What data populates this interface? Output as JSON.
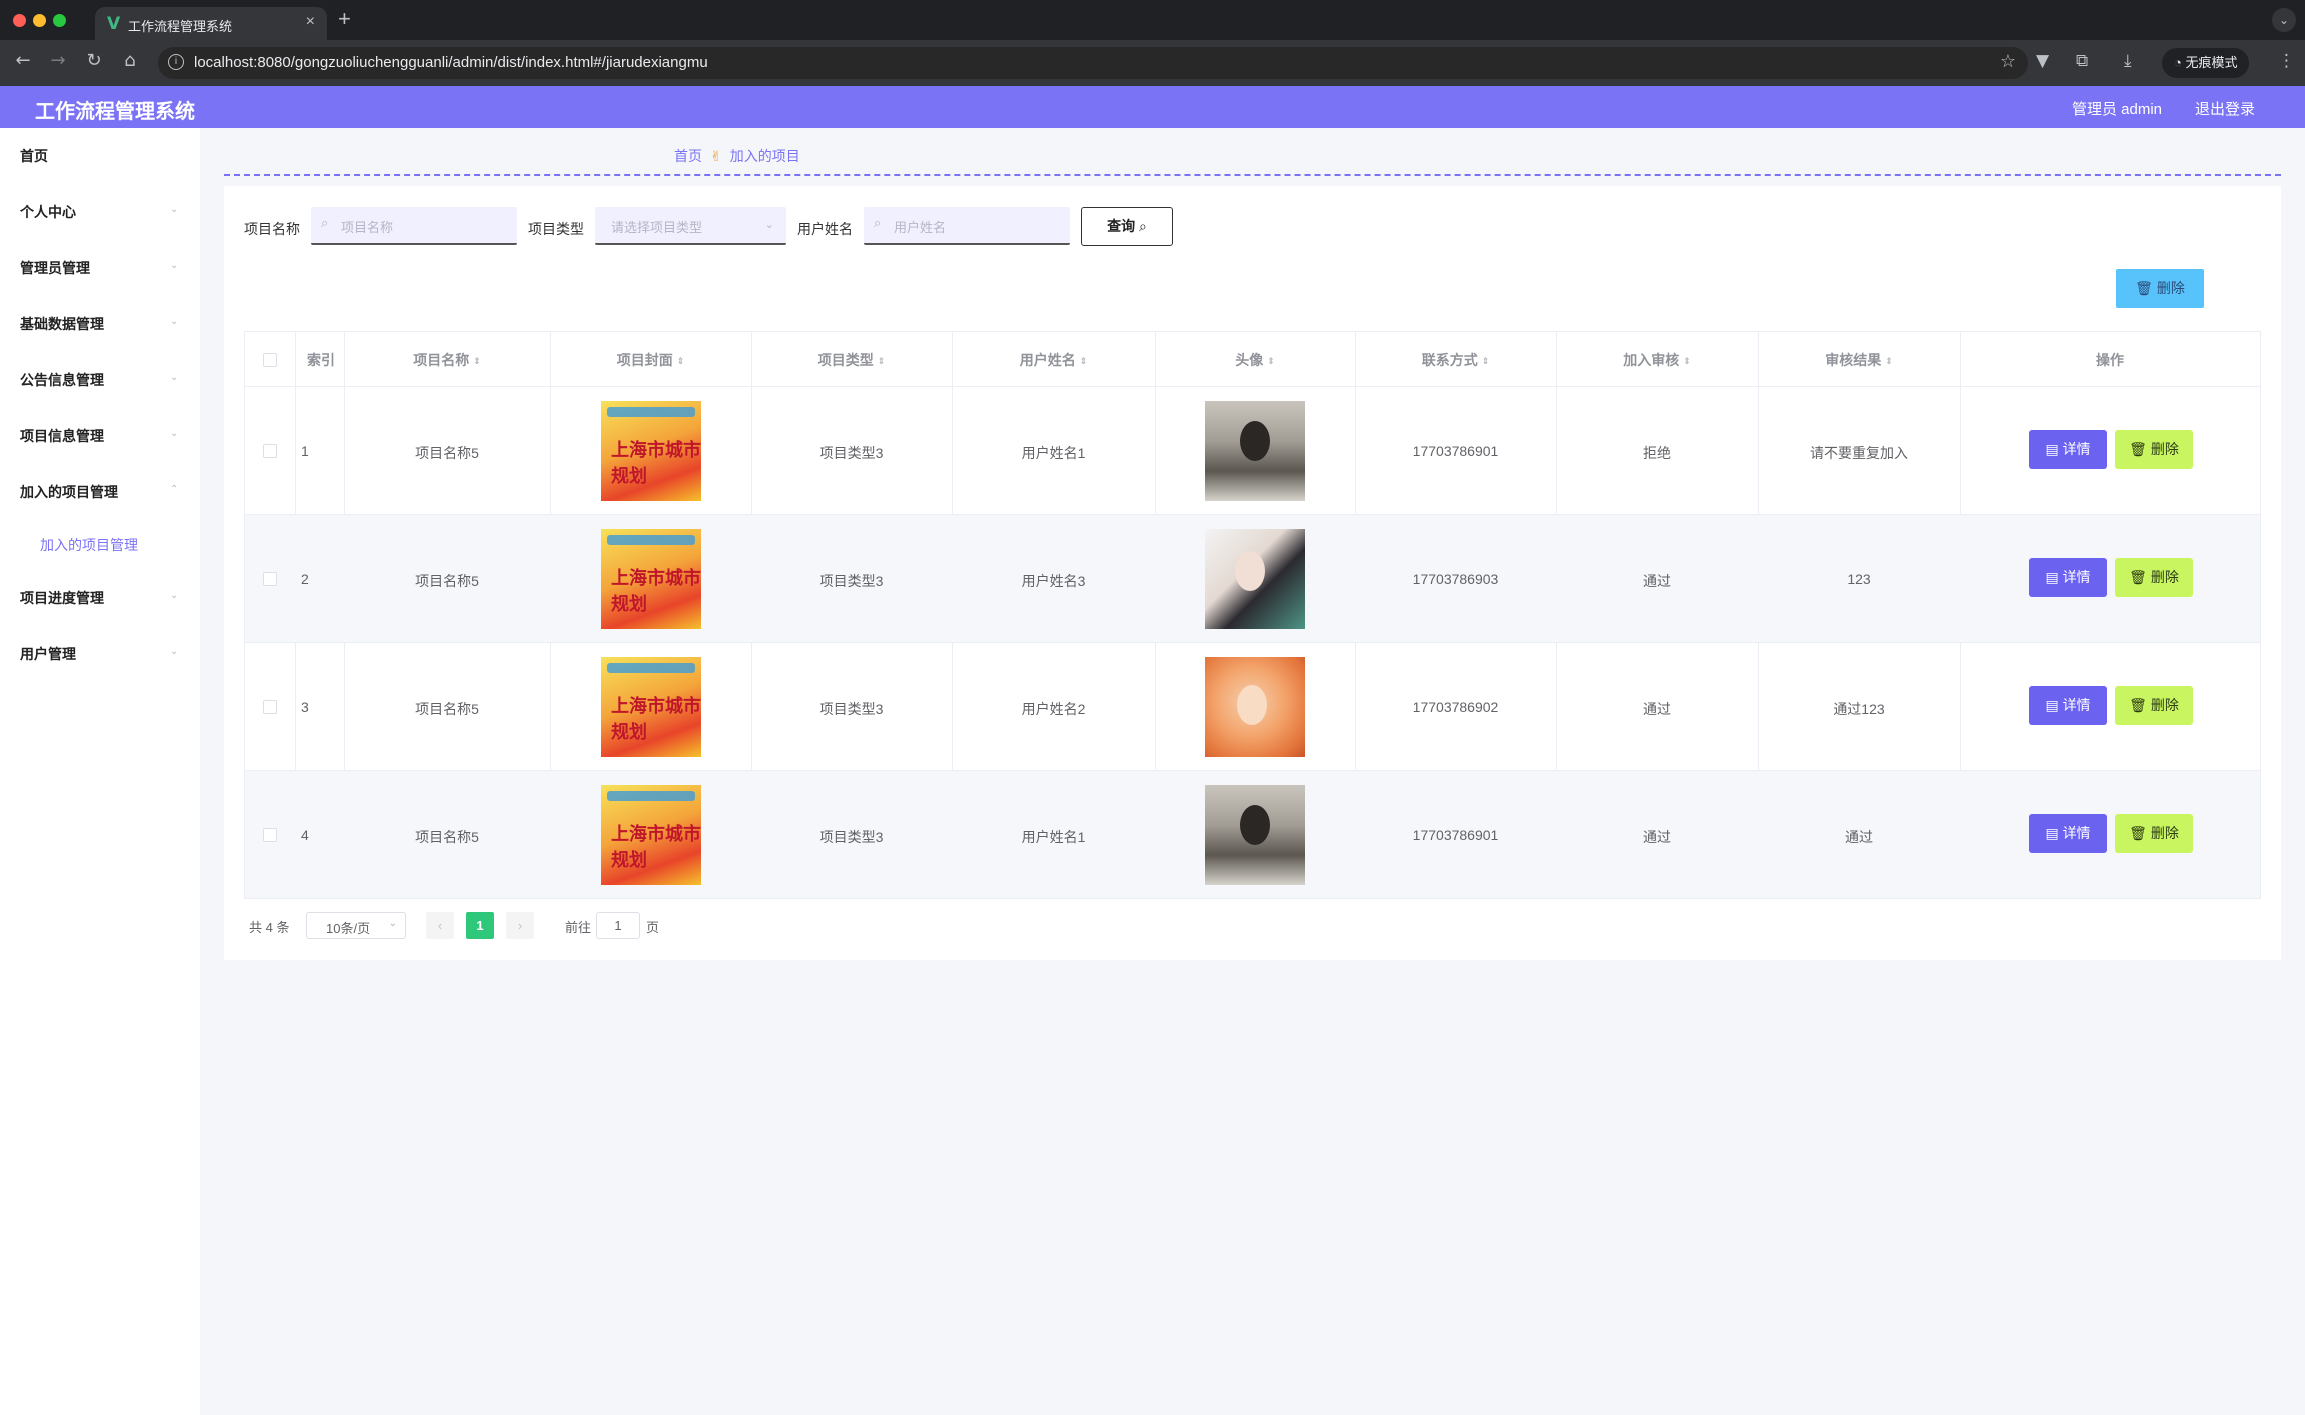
{
  "browser": {
    "tab_title": "工作流程管理系统",
    "tab_favicon": "V",
    "close_glyph": "×",
    "new_tab_glyph": "+",
    "url": "localhost:8080/gongzuoliuchengguanli/admin/dist/index.html#/jiarudexiangmu",
    "incognito_label": "无痕模式"
  },
  "header": {
    "title": "工作流程管理系统",
    "admin_label": "管理员 admin",
    "logout_label": "退出登录"
  },
  "sidebar": {
    "items": [
      {
        "label": "首页"
      },
      {
        "label": "个人中心"
      },
      {
        "label": "管理员管理"
      },
      {
        "label": "基础数据管理"
      },
      {
        "label": "公告信息管理"
      },
      {
        "label": "项目信息管理"
      },
      {
        "label": "加入的项目管理"
      },
      {
        "label": "项目进度管理"
      },
      {
        "label": "用户管理"
      }
    ],
    "submenu": {
      "label": "加入的项目管理"
    }
  },
  "breadcrumb": {
    "home": "首页",
    "separator": "✌",
    "current": "加入的项目"
  },
  "search": {
    "project_name_label": "项目名称",
    "project_name_placeholder": "项目名称",
    "project_type_label": "项目类型",
    "project_type_placeholder": "请选择项目类型",
    "user_name_label": "用户姓名",
    "user_name_placeholder": "用户姓名",
    "query_label": "查询"
  },
  "actions": {
    "batch_delete_label": "删除"
  },
  "table": {
    "columns": [
      "索引",
      "项目名称",
      "项目封面",
      "项目类型",
      "用户姓名",
      "头像",
      "联系方式",
      "加入审核",
      "审核结果",
      "操作"
    ],
    "rows": [
      {
        "index": "1",
        "project_name": "项目名称5",
        "project_type": "项目类型3",
        "user_name": "用户姓名1",
        "phone": "17703786901",
        "review": "拒绝",
        "result": "请不要重复加入",
        "avatar": "avatar-a"
      },
      {
        "index": "2",
        "project_name": "项目名称5",
        "project_type": "项目类型3",
        "user_name": "用户姓名3",
        "phone": "17703786903",
        "review": "通过",
        "result": "123",
        "avatar": "avatar-b"
      },
      {
        "index": "3",
        "project_name": "项目名称5",
        "project_type": "项目类型3",
        "user_name": "用户姓名2",
        "phone": "17703786902",
        "review": "通过",
        "result": "通过123",
        "avatar": "avatar-c"
      },
      {
        "index": "4",
        "project_name": "项目名称5",
        "project_type": "项目类型3",
        "user_name": "用户姓名1",
        "phone": "17703786901",
        "review": "通过",
        "result": "通过",
        "avatar": "avatar-a"
      }
    ],
    "detail_label": "详情",
    "delete_label": "删除",
    "cover_text": "上海市城市规划"
  },
  "pagination": {
    "total": "共 4 条",
    "page_size": "10条/页",
    "current_page": "1",
    "goto_label": "前往",
    "goto_value": "1",
    "page_suffix": "页",
    "prev_glyph": "‹",
    "next_glyph": "›"
  },
  "colors": {
    "accent": "#7b73f5",
    "detail_button": "#6b63f0",
    "delete_button": "#c9f560",
    "batch_delete": "#57c3fa",
    "page_active": "#2fc77a"
  }
}
